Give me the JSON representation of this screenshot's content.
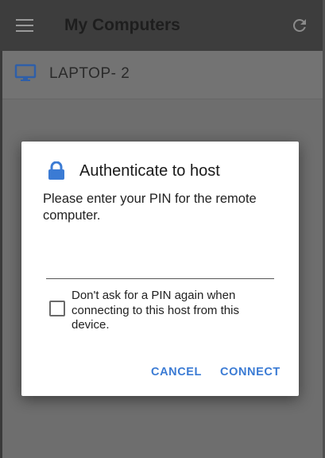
{
  "app": {
    "title": "My Computers",
    "computers": [
      {
        "label": "LAPTOP- 2",
        "icon": "monitor-icon"
      }
    ]
  },
  "dialog": {
    "title": "Authenticate to host",
    "message": "Please enter your PIN for the remote computer.",
    "pin_value": "",
    "remember_label": "Don't ask for a PIN again when connecting to this host from this device.",
    "remember_checked": false,
    "cancel_label": "CANCEL",
    "connect_label": "CONNECT"
  },
  "colors": {
    "accent": "#3b7bd4",
    "dialog_bg": "#ffffff",
    "scrim": "#6e6e6e"
  }
}
